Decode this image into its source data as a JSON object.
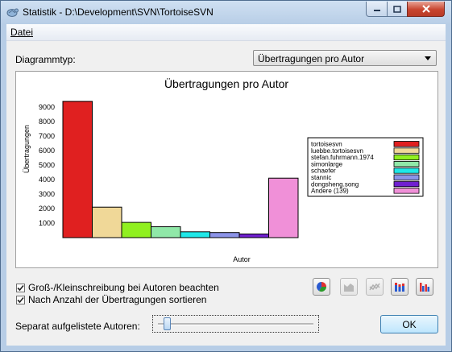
{
  "window": {
    "title": "Statistik - D:\\Development\\SVN\\TortoiseSVN"
  },
  "menu": {
    "file_label": "Datei"
  },
  "chart_type": {
    "label": "Diagrammtyp:",
    "selected": "Übertragungen pro Autor"
  },
  "chart_data": {
    "type": "bar",
    "title": "Übertragungen pro Autor",
    "xlabel": "Autor",
    "ylabel": "Übertragungen",
    "ylim": [
      0,
      10000
    ],
    "yticks": [
      1000,
      2000,
      3000,
      4000,
      5000,
      6000,
      7000,
      8000,
      9000
    ],
    "categories": [
      "tortoisesvn",
      "luebbe.tortoisesvn",
      "stefan.fuhrmann.1974",
      "simonlarge",
      "schaefer",
      "stannic",
      "dongsheng.song",
      "Andere (139)"
    ],
    "values": [
      9400,
      2100,
      1050,
      750,
      400,
      350,
      250,
      4100
    ],
    "colors": [
      "#e02020",
      "#f0d898",
      "#90f020",
      "#90e8a8",
      "#20e8e8",
      "#8c94e8",
      "#7020d0",
      "#f090d8"
    ],
    "legend_placement": "right"
  },
  "options": {
    "case_sensitive_label": "Groß-/Kleinschreibung bei Autoren beachten",
    "case_sensitive_checked": true,
    "sort_label": "Nach Anzahl der Übertragungen sortieren",
    "sort_checked": true
  },
  "chart_buttons": [
    {
      "name": "pie-chart-button",
      "icon": "pie-chart-icon"
    },
    {
      "name": "area-chart-button",
      "icon": "area-chart-icon"
    },
    {
      "name": "line-chart-button",
      "icon": "line-chart-icon"
    },
    {
      "name": "stacked-bar-chart-button",
      "icon": "stacked-bar-chart-icon"
    },
    {
      "name": "bar-chart-button",
      "icon": "bar-chart-icon"
    }
  ],
  "authors_slider": {
    "label": "Separat aufgelistete Autoren:",
    "value_fraction": 0.04
  },
  "ok_label": "OK"
}
